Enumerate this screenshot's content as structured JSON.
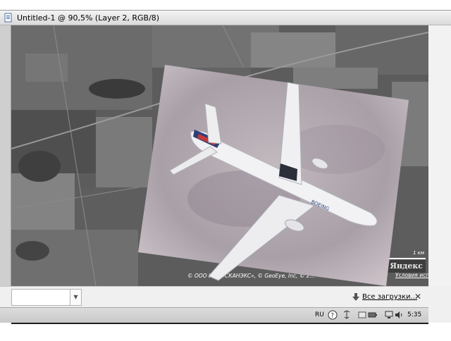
{
  "window": {
    "title": "Untitled-1 @ 90,5% (Layer 2, RGB/8)"
  },
  "map": {
    "credit": "© ООО ИТЦ «СКАНЭКС», © GeoEye, Inc, © 2...",
    "usage_link": "Условия использования",
    "scale_label": "1 км",
    "logo": "Яндекс"
  },
  "download_bar": {
    "all_downloads_label": "Все загрузки...",
    "close_label": "✕",
    "field_arrow": "▼"
  },
  "taskbar": {
    "language": "RU",
    "clock": "5:35"
  },
  "icons": {
    "document": "document-icon",
    "help": "help-icon",
    "network": "network-icon",
    "battery": "battery-icon",
    "volume": "volume-icon",
    "download": "download-arrow-icon"
  },
  "colors": {
    "titlebar": "#e6e6e6",
    "photo_sky": "#b2a9b0",
    "map_gray": "#5a5a5a"
  }
}
